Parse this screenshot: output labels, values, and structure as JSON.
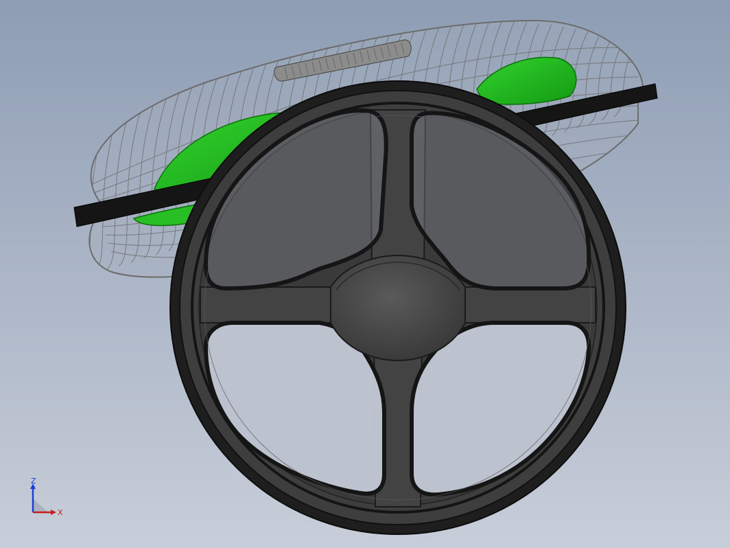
{
  "scene": {
    "background_top": "#8e9db4",
    "background_bottom": "#c8ced9"
  },
  "model": {
    "icon": "pedestal-fan-model",
    "grille_color": "#7b7b7b",
    "blade_color": "#22c01e",
    "ring_color": "#151515",
    "base_color": "#3a3a3a"
  },
  "triad": {
    "z_label": "Z",
    "x_label": "X",
    "z_color": "#1e3fd6",
    "x_color": "#c81e1e"
  }
}
